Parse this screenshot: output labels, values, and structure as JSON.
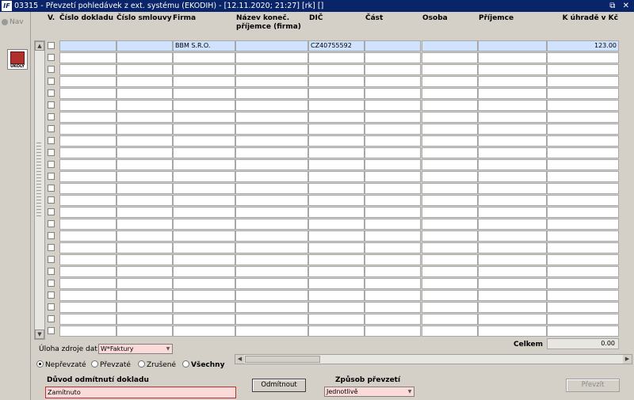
{
  "window": {
    "title": "03315 - Převzetí pohledávek z ext. systému (EKODIH) - [12.11.2020; 21:27] [rk] []",
    "logo": "IF",
    "controls": "⧉ ✕"
  },
  "sidebar": {
    "nav_label": "Nav",
    "ukoly_label": "ÚKOLY"
  },
  "table": {
    "headers": [
      "V.",
      "Číslo dokladu",
      "Číslo smlouvy",
      "Firma",
      "Název koneč. příjemce (firma)",
      "DIČ",
      "Část",
      "Osoba",
      "Příjemce",
      "K úhradě v Kč"
    ],
    "rows": [
      [
        "",
        "",
        "",
        "BBM S.R.O.",
        "",
        "CZ40755592",
        "",
        "",
        "",
        "123.00"
      ]
    ],
    "empty_row_count": 24,
    "total_label": "Celkem",
    "total_value": "0.00"
  },
  "controls": {
    "source_task_label": "Úloha zdroje dat",
    "source_task_value": "W*Faktury",
    "radios": [
      "Nepřevzaté",
      "Převzaté",
      "Zrušené",
      "Všechny"
    ],
    "radio_selected": 0,
    "reason_label": "Důvod odmítnutí dokladu",
    "reason_value": "Zamítnuto",
    "reject_button": "Odmítnout",
    "method_label": "Způsob převzetí",
    "method_value": "Jednotlivě",
    "transfer_button": "Převzít"
  }
}
